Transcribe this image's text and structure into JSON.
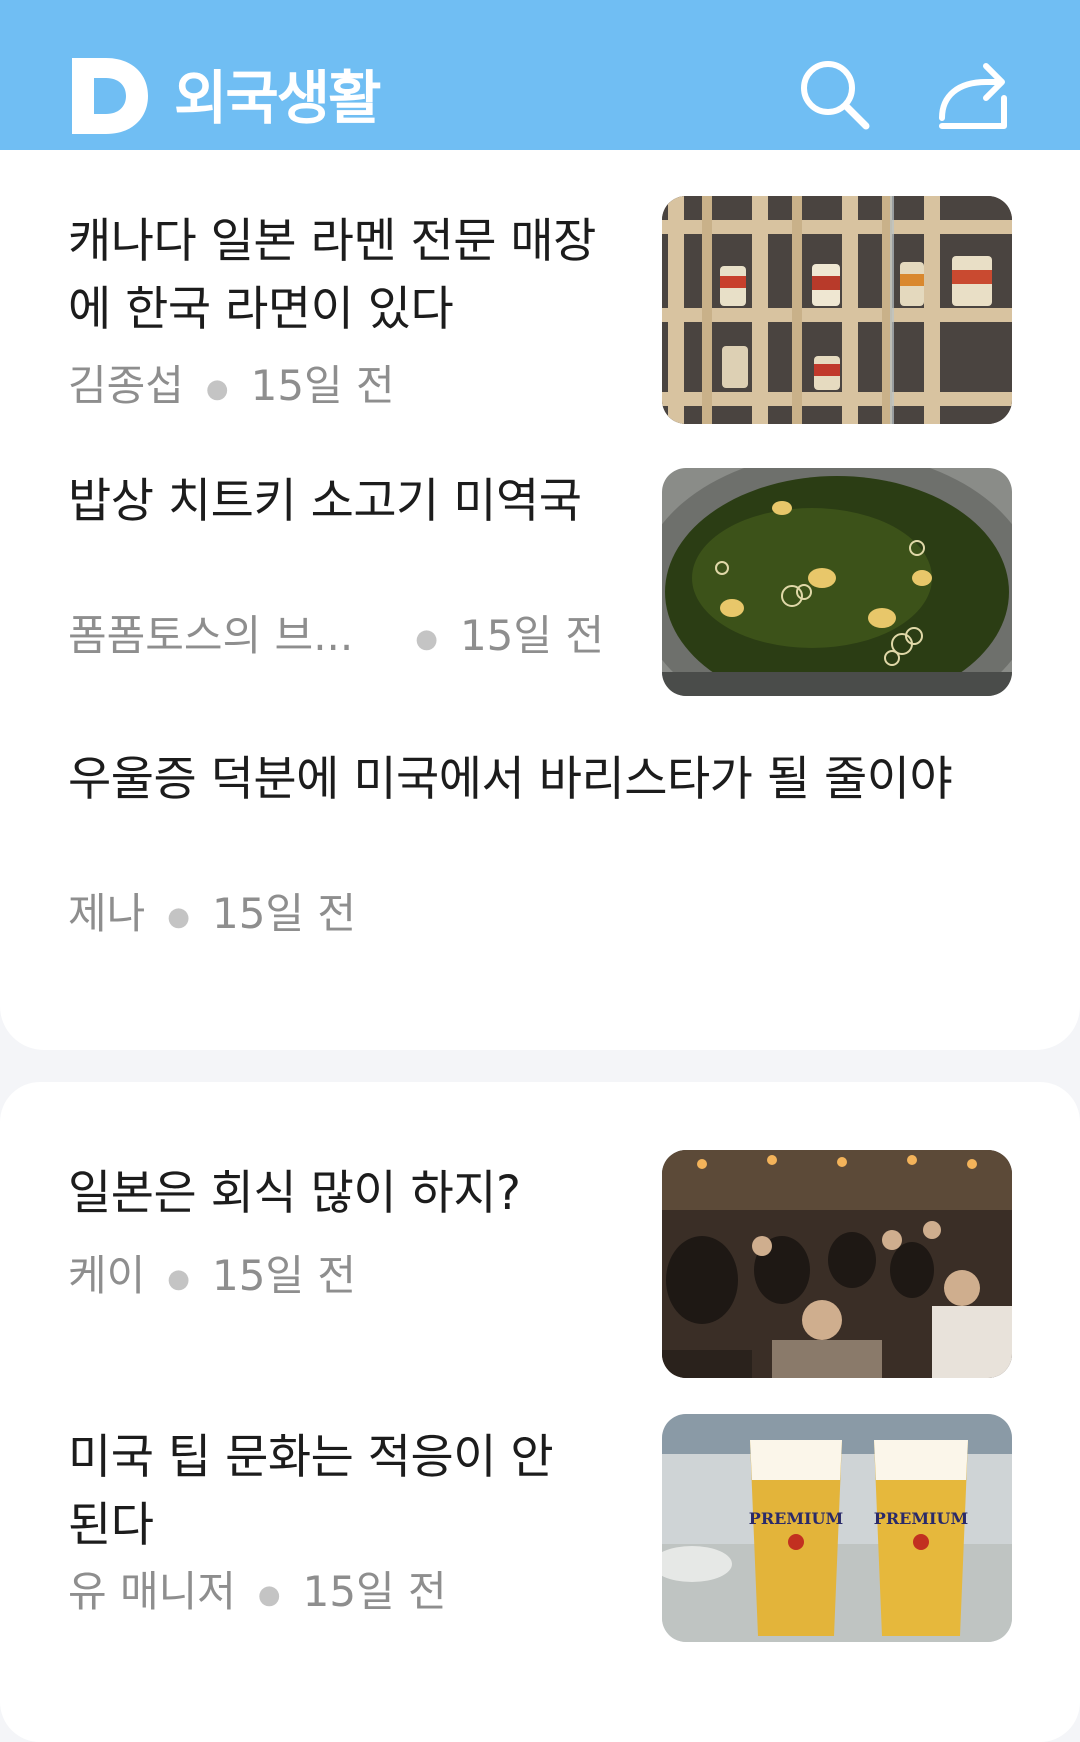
{
  "header": {
    "logo_letter": "D",
    "title": "외국생활",
    "search_icon": "search-icon",
    "share_icon": "share-icon",
    "background_color": "#70bef3"
  },
  "articles": [
    {
      "title": "캐나다 일본 라멘 전문 매장에 한국 라면이 있다",
      "author": "김종섭",
      "time": "15일 전",
      "has_thumbnail": true
    },
    {
      "title": "밥상 치트키 소고기 미역국",
      "author": "폼폼토스의 브...",
      "time": "15일 전",
      "has_thumbnail": true
    },
    {
      "title": "우울증 덕분에 미국에서 바리스타가 될 줄이야",
      "author": "제나",
      "time": "15일 전",
      "has_thumbnail": false
    },
    {
      "title": "일본은 회식 많이 하지?",
      "author": "케이",
      "time": "15일 전",
      "has_thumbnail": true
    },
    {
      "title": "미국 팁 문화는 적응이 안 된다",
      "author": "유 매니저",
      "time": "15일 전",
      "has_thumbnail": true
    }
  ],
  "thumb_labels": {
    "beer_brand": "PREMIUM"
  }
}
